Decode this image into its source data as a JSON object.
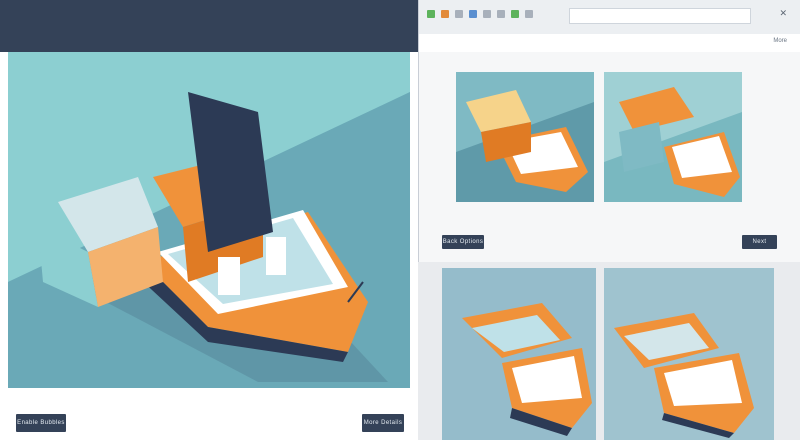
{
  "hero": {
    "left_button_label": "Enable Bubbles",
    "right_button_label": "More Details"
  },
  "window": {
    "header_button_label": "More",
    "close_glyph": "✕",
    "left_button_label": "Back Options",
    "right_button_label": "Next"
  },
  "colors": {
    "navy": "#344258",
    "teal": "#79bfc4",
    "orange": "#f0923a",
    "white": "#ffffff"
  },
  "icons": [
    "toolbar-icon",
    "close-icon",
    "boat-illustration"
  ]
}
